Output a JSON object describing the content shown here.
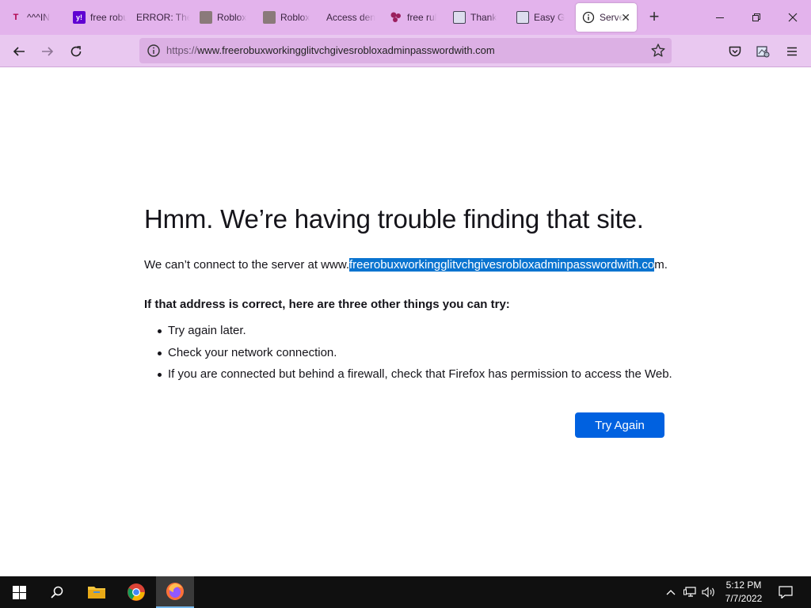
{
  "browser": {
    "tabs": [
      {
        "label": "^^^IN",
        "favicon": "roblox-like-icon"
      },
      {
        "label": "free robux",
        "favicon": "yahoo-icon"
      },
      {
        "label": "ERROR: The",
        "favicon": "none"
      },
      {
        "label": "Roblox",
        "favicon": "roblox-thumbnail-icon"
      },
      {
        "label": "Roblox",
        "favicon": "roblox-thumbnail-icon"
      },
      {
        "label": "Access den",
        "favicon": "none"
      },
      {
        "label": "free rul",
        "favicon": "dots-icon"
      },
      {
        "label": "Thank",
        "favicon": "page-icon"
      },
      {
        "label": "Easy G",
        "favicon": "page-icon"
      },
      {
        "label": "Serve",
        "favicon": "info-icon",
        "active": true
      }
    ],
    "url": {
      "scheme": "https://",
      "host": "www.freerobuxworkingglitvchgivesrobloxadminpasswordwith.com"
    }
  },
  "page": {
    "title": "Hmm. We’re having trouble finding that site.",
    "desc_prefix": "We can’t connect to the server at www.",
    "desc_selected": "freerobuxworkingglitvchgivesrobloxadminpasswordwith.co",
    "desc_suffix": "m.",
    "subheading": "If that address is correct, here are three other things you can try:",
    "tips": [
      "Try again later.",
      "Check your network connection.",
      "If you are connected but behind a firewall, check that Firefox has permission to access the Web."
    ],
    "try_again_label": "Try Again"
  },
  "taskbar": {
    "time": "5:12 PM",
    "date": "7/7/2022"
  },
  "colors": {
    "tabstrip": "#e3b3ec",
    "navbar": "#e9c8f0",
    "primary_button": "#0061e0",
    "selection": "#0a74d0"
  }
}
